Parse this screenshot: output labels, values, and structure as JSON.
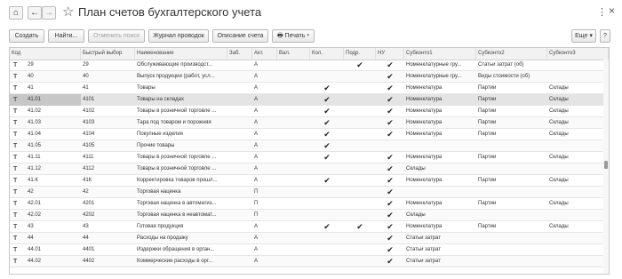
{
  "header": {
    "home_icon": "⌂",
    "back_icon": "←",
    "forward_icon": "→",
    "star_icon": "☆",
    "title": "План счетов бухгалтерского учета",
    "more_icon": "⋮",
    "close_icon": "×"
  },
  "toolbar": {
    "create": "Создать",
    "find": "Найти...",
    "cancel_search": "Отменить поиск",
    "journal": "Журнал проводок",
    "description": "Описание счета",
    "print": "🖶 Печать ▾",
    "more": "Еще ▾",
    "help": "?"
  },
  "columns": [
    "Код",
    "Быстрый выбор",
    "Наименование",
    "Заб.",
    "Акт.",
    "Вал.",
    "Кол.",
    "Подр.",
    "НУ",
    "Субконто1",
    "Субконто2",
    "Субконто3"
  ],
  "rows": [
    {
      "icon": "T",
      "code": "29",
      "quick": "29",
      "name": "Обслуживающие производст...",
      "zab": "",
      "akt": "А",
      "val": "",
      "kol": "",
      "podr": "✔",
      "nu": "✔",
      "s1": "Номенклатурные гру...",
      "s2": "Статьи затрат (об)",
      "s3": ""
    },
    {
      "icon": "T",
      "code": "40",
      "quick": "40",
      "name": "Выпуск продукции (работ, усл...",
      "zab": "",
      "akt": "А",
      "val": "",
      "kol": "",
      "podr": "",
      "nu": "✔",
      "s1": "Номенклатурные гру...",
      "s2": "Виды стоимости (об)",
      "s3": ""
    },
    {
      "icon": "T",
      "code": "41",
      "quick": "41",
      "name": "Товары",
      "zab": "",
      "akt": "А",
      "val": "",
      "kol": "✔",
      "podr": "",
      "nu": "✔",
      "s1": "Номенклатура",
      "s2": "Партии",
      "s3": "Склады"
    },
    {
      "icon": "T",
      "code": "41.01",
      "quick": "4101",
      "name": "Товары на складах",
      "zab": "",
      "akt": "А",
      "val": "",
      "kol": "✔",
      "podr": "",
      "nu": "✔",
      "s1": "Номенклатура",
      "s2": "Партии",
      "s3": "Склады"
    },
    {
      "icon": "T",
      "code": "41.02",
      "quick": "4102",
      "name": "Товары в розничной торговле ...",
      "zab": "",
      "akt": "А",
      "val": "",
      "kol": "✔",
      "podr": "",
      "nu": "✔",
      "s1": "Номенклатура",
      "s2": "Партии",
      "s3": "Склады"
    },
    {
      "icon": "T",
      "code": "41.03",
      "quick": "4103",
      "name": "Тара под товаром и порожняя",
      "zab": "",
      "akt": "А",
      "val": "",
      "kol": "✔",
      "podr": "",
      "nu": "✔",
      "s1": "Номенклатура",
      "s2": "Партии",
      "s3": "Склады"
    },
    {
      "icon": "T",
      "code": "41.04",
      "quick": "4104",
      "name": "Покупные изделия",
      "zab": "",
      "akt": "А",
      "val": "",
      "kol": "✔",
      "podr": "",
      "nu": "✔",
      "s1": "Номенклатура",
      "s2": "Партии",
      "s3": "Склады"
    },
    {
      "icon": "T",
      "code": "41.05",
      "quick": "4105",
      "name": "Прочие товары",
      "zab": "",
      "akt": "А",
      "val": "",
      "kol": "✔",
      "podr": "",
      "nu": "",
      "s1": "",
      "s2": "",
      "s3": ""
    },
    {
      "icon": "T",
      "code": "41.11",
      "quick": "4111",
      "name": "Товары в розничной торговле ...",
      "zab": "",
      "akt": "А",
      "val": "",
      "kol": "✔",
      "podr": "",
      "nu": "✔",
      "s1": "Номенклатура",
      "s2": "Партии",
      "s3": "Склады"
    },
    {
      "icon": "T",
      "code": "41.12",
      "quick": "4112",
      "name": "Товары в розничной торговле ...",
      "zab": "",
      "akt": "А",
      "val": "",
      "kol": "",
      "podr": "",
      "nu": "✔",
      "s1": "Склады",
      "s2": "",
      "s3": ""
    },
    {
      "icon": "T",
      "code": "41.К",
      "quick": "41К",
      "name": "Корректировка товаров прошл...",
      "zab": "",
      "akt": "А",
      "val": "",
      "kol": "✔",
      "podr": "",
      "nu": "✔",
      "s1": "Номенклатура",
      "s2": "Партии",
      "s3": "Склады"
    },
    {
      "icon": "T",
      "code": "42",
      "quick": "42",
      "name": "Торговая наценка",
      "zab": "",
      "akt": "П",
      "val": "",
      "kol": "",
      "podr": "",
      "nu": "✔",
      "s1": "",
      "s2": "",
      "s3": ""
    },
    {
      "icon": "T",
      "code": "42.01",
      "quick": "4201",
      "name": "Торговая наценка в автоматиз...",
      "zab": "",
      "akt": "П",
      "val": "",
      "kol": "",
      "podr": "",
      "nu": "✔",
      "s1": "Номенклатура",
      "s2": "Партии",
      "s3": "Склады"
    },
    {
      "icon": "T",
      "code": "42.02",
      "quick": "4202",
      "name": "Торговая наценка в неавтомат...",
      "zab": "",
      "akt": "П",
      "val": "",
      "kol": "",
      "podr": "",
      "nu": "✔",
      "s1": "Склады",
      "s2": "",
      "s3": ""
    },
    {
      "icon": "T",
      "code": "43",
      "quick": "43",
      "name": "Готовая продукция",
      "zab": "",
      "akt": "А",
      "val": "",
      "kol": "✔",
      "podr": "✔",
      "nu": "✔",
      "s1": "Номенклатура",
      "s2": "Партии",
      "s3": "Склады"
    },
    {
      "icon": "T",
      "code": "44",
      "quick": "44",
      "name": "Расходы на продажу",
      "zab": "",
      "akt": "А",
      "val": "",
      "kol": "",
      "podr": "",
      "nu": "✔",
      "s1": "Статьи затрат",
      "s2": "",
      "s3": ""
    },
    {
      "icon": "T",
      "code": "44.01",
      "quick": "4401",
      "name": "Издержки обращения в орган...",
      "zab": "",
      "akt": "А",
      "val": "",
      "kol": "",
      "podr": "",
      "nu": "✔",
      "s1": "Статьи затрат",
      "s2": "",
      "s3": ""
    },
    {
      "icon": "T",
      "code": "44.02",
      "quick": "4402",
      "name": "Коммерческие расходы в орг...",
      "zab": "",
      "akt": "А",
      "val": "",
      "kol": "",
      "podr": "",
      "nu": "✔",
      "s1": "Статьи затрат",
      "s2": "",
      "s3": ""
    }
  ]
}
